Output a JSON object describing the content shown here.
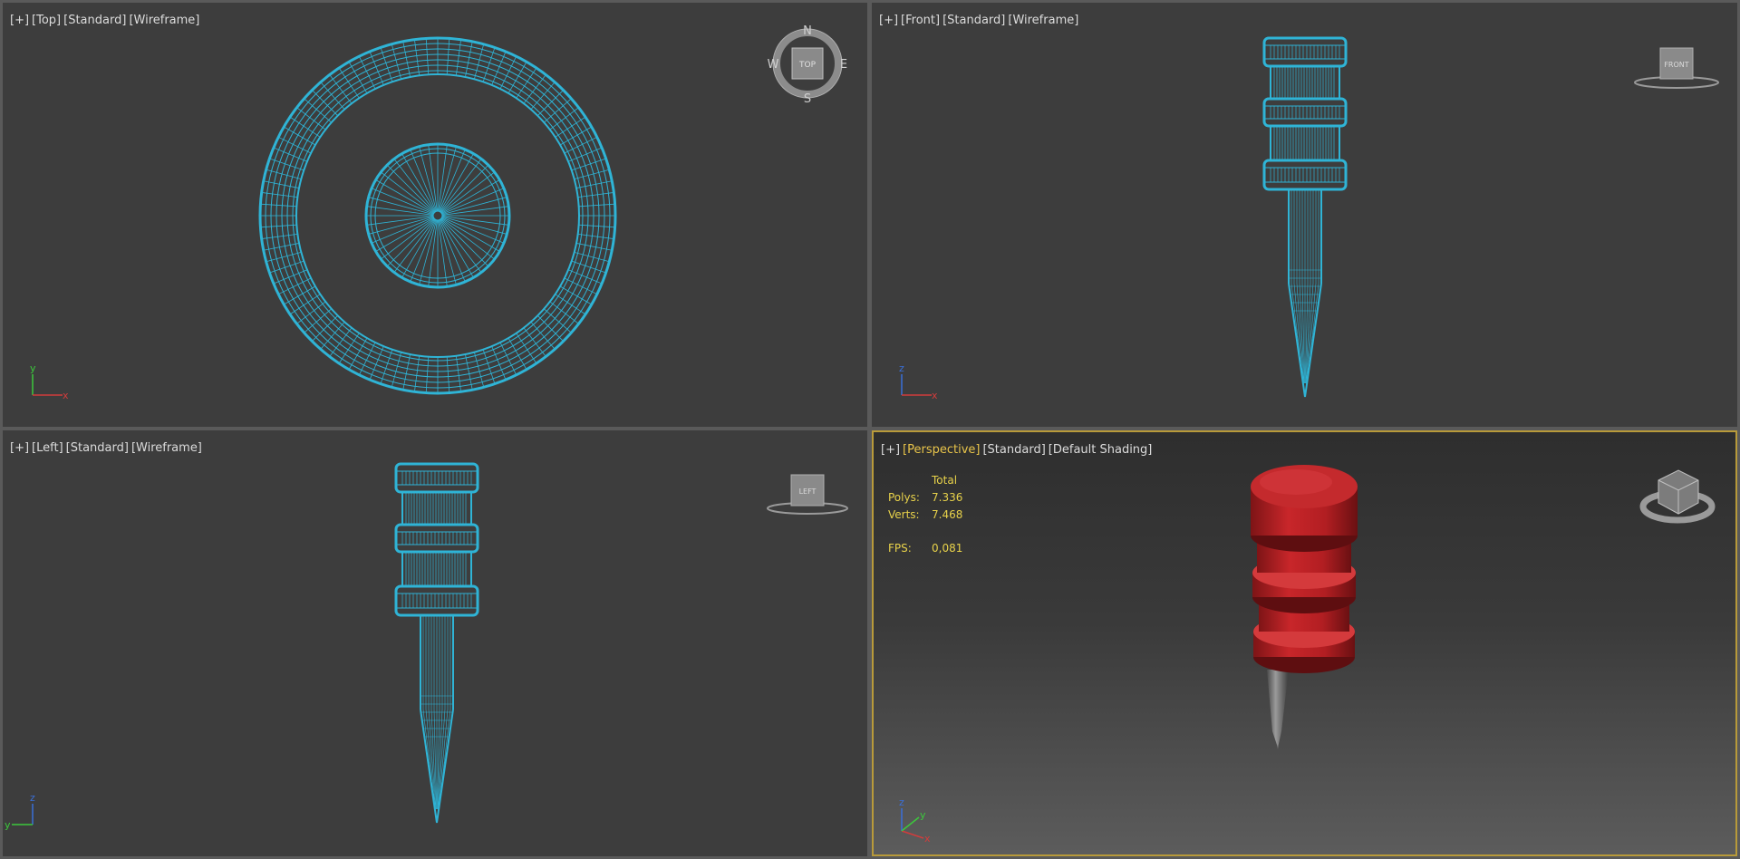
{
  "viewports": {
    "top": {
      "plus": "[+]",
      "view": "[Top]",
      "standard": "[Standard]",
      "shading": "[Wireframe]",
      "cube_label": "TOP",
      "compass": {
        "n": "N",
        "s": "S",
        "e": "E",
        "w": "W"
      },
      "axis": {
        "v": "y",
        "h": "x"
      }
    },
    "front": {
      "plus": "[+]",
      "view": "[Front]",
      "standard": "[Standard]",
      "shading": "[Wireframe]",
      "cube_label": "FRONT",
      "axis": {
        "v": "z",
        "h": "x"
      }
    },
    "left": {
      "plus": "[+]",
      "view": "[Left]",
      "standard": "[Standard]",
      "shading": "[Wireframe]",
      "cube_label": "LEFT",
      "axis": {
        "v": "z",
        "h": "y"
      }
    },
    "persp": {
      "plus": "[+]",
      "view": "[Perspective]",
      "standard": "[Standard]",
      "shading": "[Default Shading]",
      "axis": {
        "v": "z",
        "h": "x",
        "d": "y"
      }
    }
  },
  "stats": {
    "header": "Total",
    "polys_label": "Polys:",
    "polys_value": "7.336",
    "verts_label": "Verts:",
    "verts_value": "7.468",
    "fps_label": "FPS:",
    "fps_value": "0,081"
  },
  "colors": {
    "wire": "#2fb4d6",
    "object": "#c8262a",
    "active_border": "#b89a3a",
    "stats_text": "#e8d24a"
  }
}
